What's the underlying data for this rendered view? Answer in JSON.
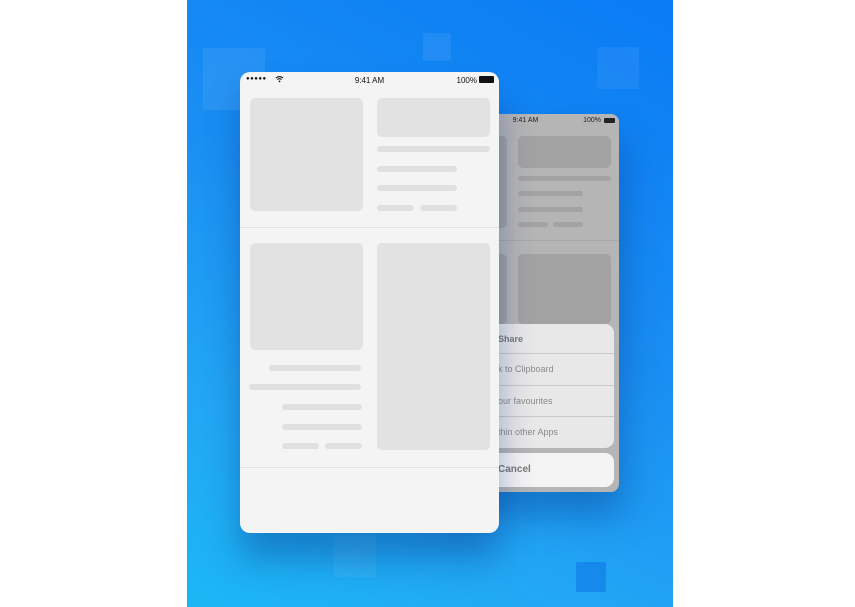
{
  "front_phone": {
    "status_bar": {
      "signal": "●●●●●",
      "time": "9:41 AM",
      "battery": "100%"
    }
  },
  "back_phone": {
    "status_bar": {
      "time": "9:41 AM",
      "battery": "100%"
    },
    "share_sheet": {
      "title": "Share",
      "items": [
        "k to Clipboard",
        "our favourites",
        "thin other Apps"
      ],
      "cancel": "Cancel"
    }
  },
  "icons": [
    "wifi-icon",
    "battery-icon",
    "signal-icon"
  ],
  "colors": {
    "background_gradient_top": "#0a7bf5",
    "background_gradient_bottom": "#1cb7f5",
    "placeholder": "#e2e2e2",
    "phone_surface": "#f4f4f4"
  }
}
